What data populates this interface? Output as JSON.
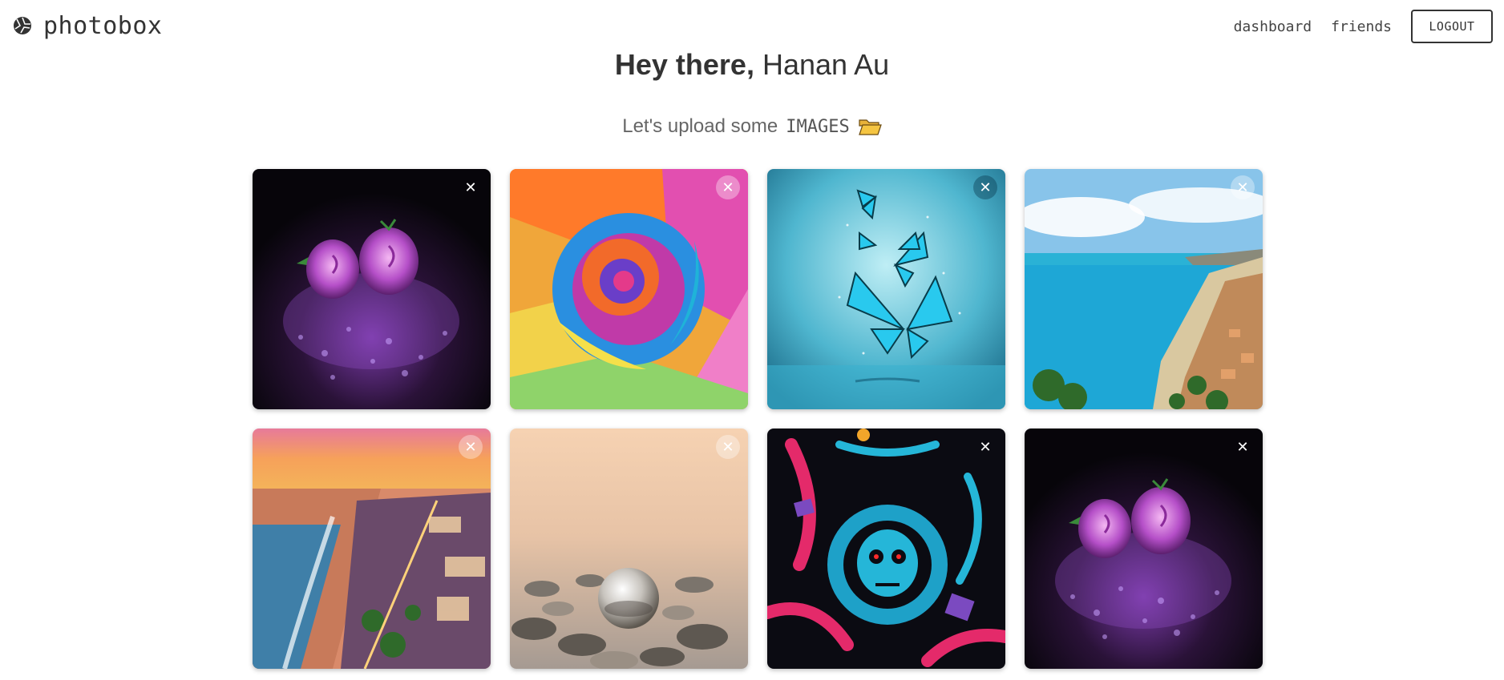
{
  "brand": {
    "name": "photobox",
    "icon": "aperture-icon"
  },
  "nav": {
    "dashboard": "dashboard",
    "friends": "friends",
    "logout": "LOGOUT"
  },
  "greeting": {
    "prefix": "Hey there,",
    "user": "Hanan Au"
  },
  "upload": {
    "text": "Let's upload some",
    "keyword": "IMAGES",
    "icon": "open-folder-icon"
  },
  "images": [
    {
      "subject": "purple roses",
      "close": "✕"
    },
    {
      "subject": "rainbow rose",
      "close": "✕"
    },
    {
      "subject": "blue butterflies",
      "close": "✕"
    },
    {
      "subject": "coastline bay",
      "close": "✕"
    },
    {
      "subject": "sunset beach city",
      "close": "✕"
    },
    {
      "subject": "glass ball on pebbles",
      "close": "✕"
    },
    {
      "subject": "astronaut skull art",
      "close": "✕"
    },
    {
      "subject": "purple roses",
      "close": "✕"
    }
  ],
  "colors": {
    "text": "#333333",
    "muted": "#666666",
    "folder": "#f5c542"
  }
}
